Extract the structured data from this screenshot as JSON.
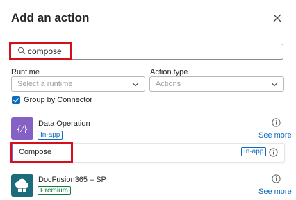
{
  "panel": {
    "title": "Add an action",
    "close_icon": "close-icon"
  },
  "search": {
    "value": "compose",
    "icon": "search-icon"
  },
  "filters": {
    "runtime_label": "Runtime",
    "runtime_placeholder": "Select a runtime",
    "action_type_label": "Action type",
    "action_type_placeholder": "Actions",
    "group_by_connector_label": "Group by Connector",
    "group_by_connector_checked": true
  },
  "connectors": [
    {
      "name": "Data Operation",
      "tag": "In-app",
      "see_more": "See more",
      "icon": "data-operation-icon",
      "color": "#8661c5",
      "actions": [
        {
          "name": "Compose",
          "tag": "In-app"
        }
      ]
    },
    {
      "name": "DocFusion365 – SP",
      "tag": "Premium",
      "see_more": "See more",
      "icon": "docfusion-cloud-icon",
      "color": "#1b6b7a"
    }
  ],
  "colors": {
    "accent_blue": "#0f6cbd",
    "premium_green": "#107c41",
    "highlight_red": "#d4101d"
  }
}
